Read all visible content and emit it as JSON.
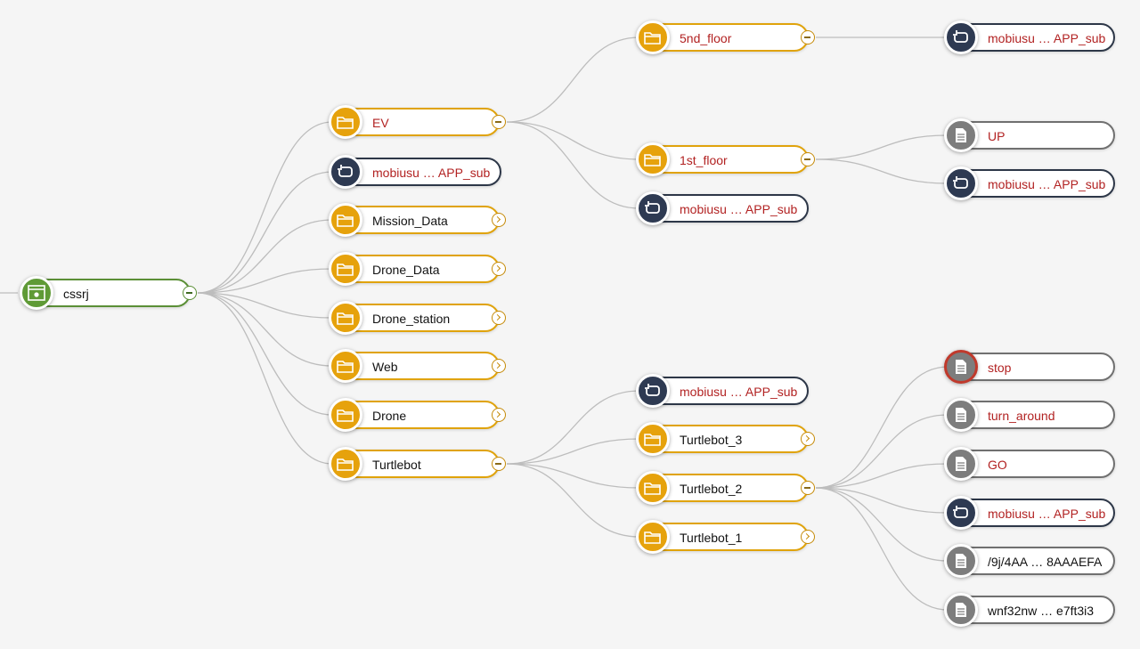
{
  "root": {
    "label": "cssrj",
    "type": "app",
    "icon": "app-window-icon"
  },
  "level1": [
    {
      "label": "EV",
      "type": "container",
      "icon": "folder-icon"
    },
    {
      "label": "mobiusu … APP_sub",
      "type": "sub",
      "icon": "subscription-icon"
    },
    {
      "label": "Mission_Data",
      "type": "container",
      "icon": "folder-icon"
    },
    {
      "label": "Drone_Data",
      "type": "container",
      "icon": "folder-icon"
    },
    {
      "label": "Drone_station",
      "type": "container",
      "icon": "folder-icon"
    },
    {
      "label": "Web",
      "type": "container",
      "icon": "folder-icon"
    },
    {
      "label": "Drone",
      "type": "container",
      "icon": "folder-icon"
    },
    {
      "label": "Turtlebot",
      "type": "container",
      "icon": "folder-icon"
    }
  ],
  "ev_children": [
    {
      "label": "5nd_floor",
      "type": "container",
      "icon": "folder-icon"
    },
    {
      "label": "1st_floor",
      "type": "container",
      "icon": "folder-icon"
    },
    {
      "label": "mobiusu … APP_sub",
      "type": "sub",
      "icon": "subscription-icon"
    }
  ],
  "floor5_children": [
    {
      "label": "mobiusu … APP_sub",
      "type": "sub",
      "icon": "subscription-icon"
    }
  ],
  "floor1_children": [
    {
      "label": "UP",
      "type": "instance",
      "icon": "document-icon"
    },
    {
      "label": "mobiusu … APP_sub",
      "type": "sub",
      "icon": "subscription-icon"
    }
  ],
  "turtlebot_children": [
    {
      "label": "mobiusu … APP_sub",
      "type": "sub",
      "icon": "subscription-icon"
    },
    {
      "label": "Turtlebot_3",
      "type": "container",
      "icon": "folder-icon"
    },
    {
      "label": "Turtlebot_2",
      "type": "container",
      "icon": "folder-icon"
    },
    {
      "label": "Turtlebot_1",
      "type": "container",
      "icon": "folder-icon"
    }
  ],
  "turtlebot2_children": [
    {
      "label": "stop",
      "type": "instance",
      "icon": "document-icon"
    },
    {
      "label": "turn_around",
      "type": "instance",
      "icon": "document-icon"
    },
    {
      "label": "GO",
      "type": "instance",
      "icon": "document-icon"
    },
    {
      "label": "mobiusu … APP_sub",
      "type": "sub",
      "icon": "subscription-icon"
    },
    {
      "label": "/9j/4AA … 8AAAEFA",
      "type": "instance",
      "icon": "document-icon"
    },
    {
      "label": "wnf32nw … e7ft3i3",
      "type": "instance",
      "icon": "document-icon"
    }
  ],
  "colors": {
    "container": "#e6a20c",
    "subscription": "#2e3a52",
    "instance": "#7d7d7d",
    "app": "#5f9a36",
    "link": "#bdbdbd",
    "label_red": "#b22222",
    "highlight": "#c0392b"
  }
}
